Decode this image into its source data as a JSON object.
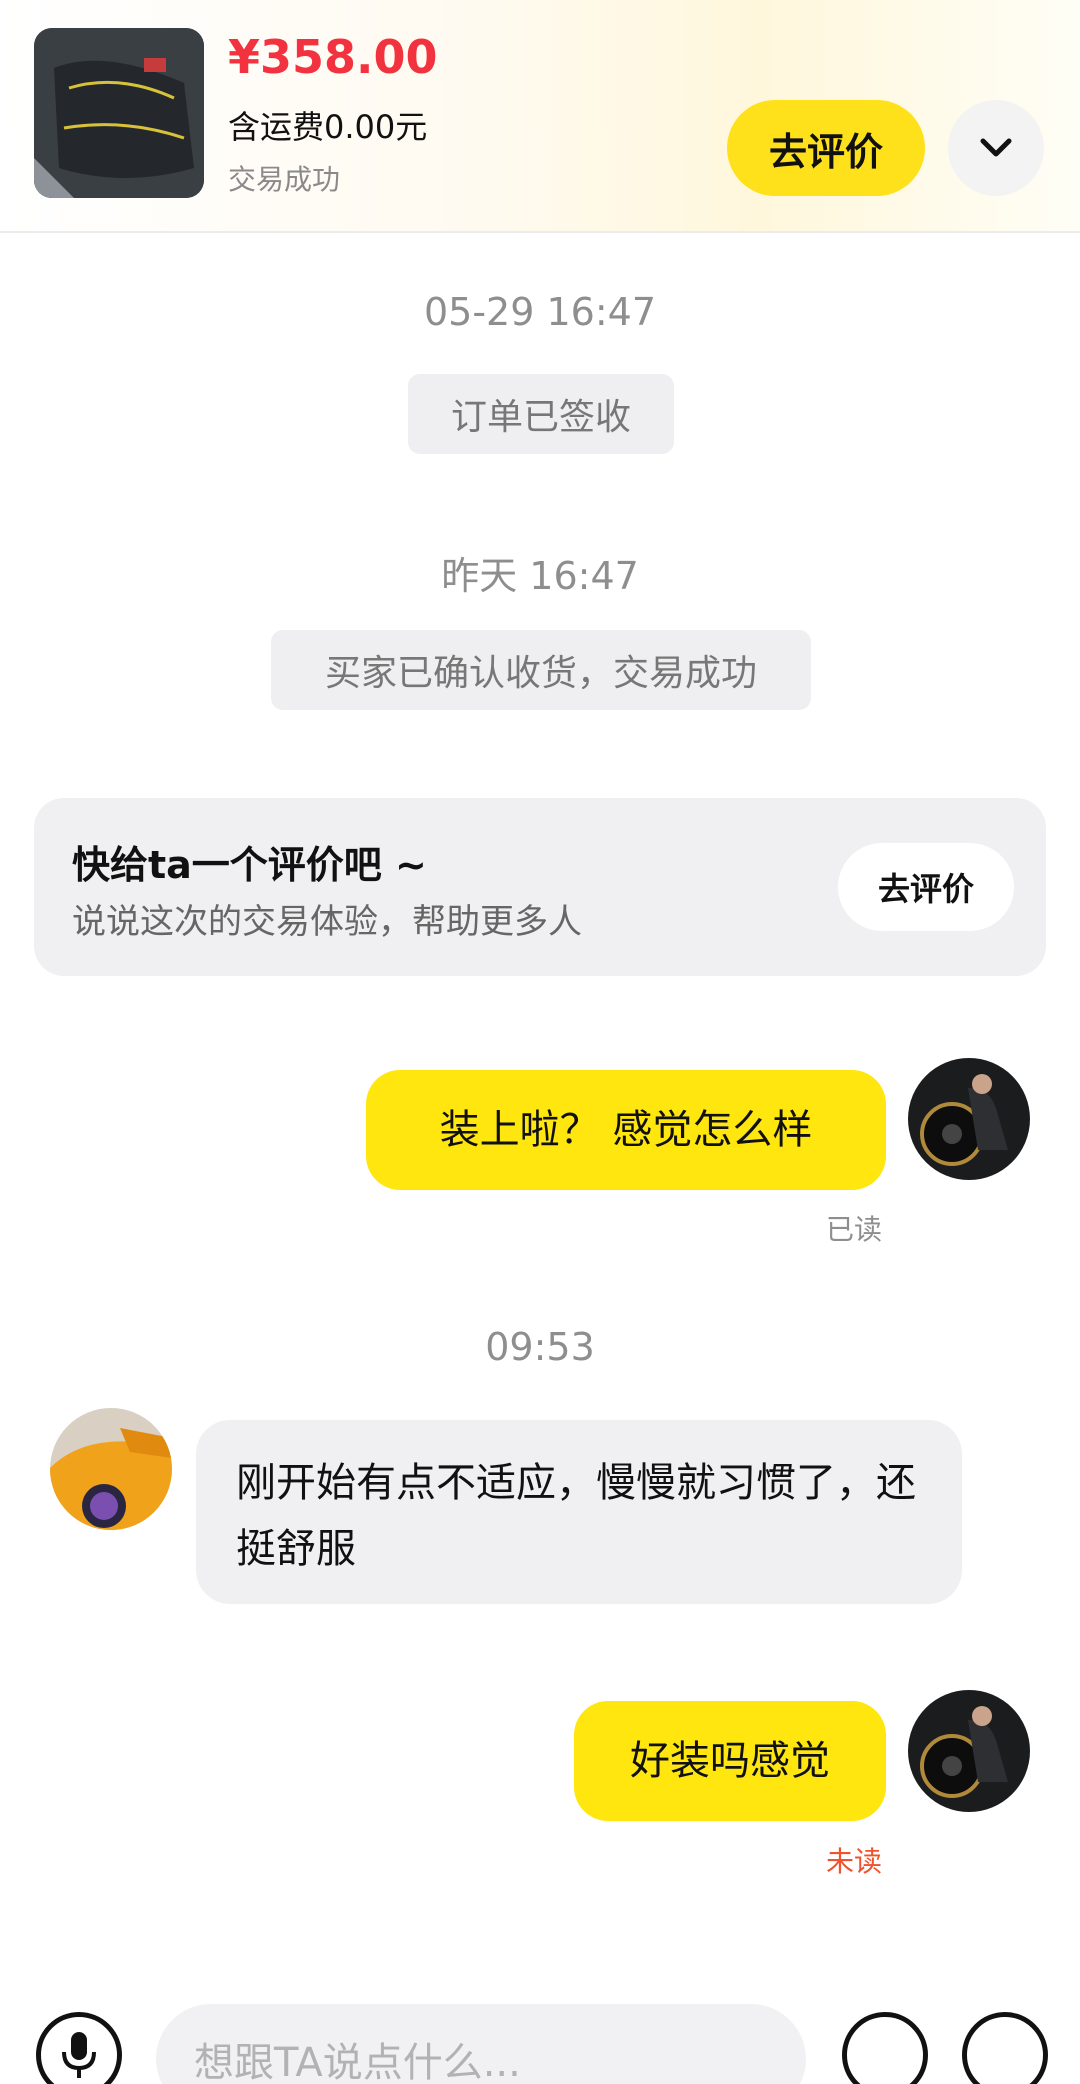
{
  "header": {
    "product_image": "car-seat-cushion-photo",
    "price": "¥358.00",
    "shipping": "含运费0.00元",
    "status": "交易成功",
    "review_button": "去评价",
    "expand_icon": "chevron-down-icon"
  },
  "timeline": {
    "time_1": "05-29 16:47",
    "system_1": "订单已签收",
    "time_2": "昨天 16:47",
    "system_2": "买家已确认收货，交易成功",
    "time_3": "09:53"
  },
  "rating_card": {
    "title": "快给ta一个评价吧 ~",
    "subtitle": "说说这次的交易体验，帮助更多人",
    "button": "去评价"
  },
  "messages": [
    {
      "sender": "me",
      "text": "装上啦？ 感觉怎么样",
      "receipt": "已读"
    },
    {
      "sender": "other",
      "text": "刚开始有点不适应，慢慢就习惯了，还挺舒服"
    },
    {
      "sender": "me",
      "text": "好装吗感觉",
      "receipt": "未读"
    }
  ],
  "input_bar": {
    "placeholder": "想跟TA说点什么...",
    "voice_icon": "microphone-icon",
    "emoji_icon": "emoji-icon",
    "plus_icon": "plus-icon"
  },
  "colors": {
    "accent_yellow": "#ffe60f",
    "price_red": "#f2323f",
    "unread_red": "#f0522d",
    "read_gray": "#8e8e8e"
  }
}
